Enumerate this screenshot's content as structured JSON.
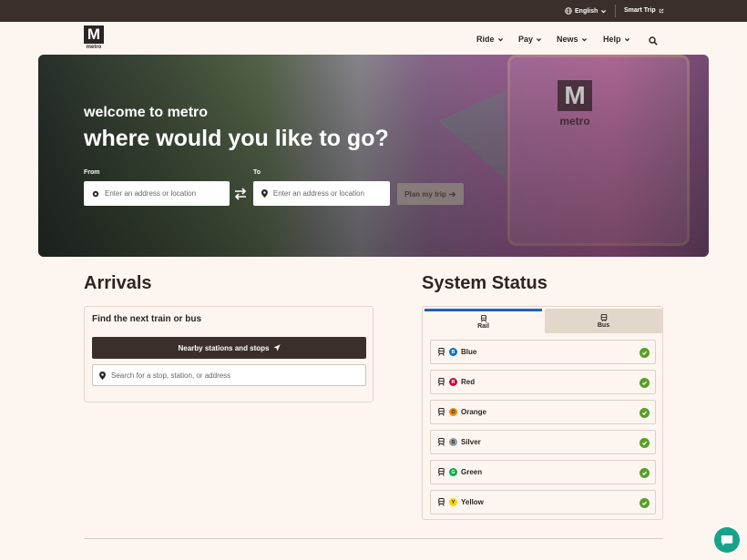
{
  "topbar": {
    "language": "English",
    "smart_trip": "Smart Trip"
  },
  "logo": {
    "mark": "M",
    "word": "metro"
  },
  "nav": {
    "items": [
      "Ride",
      "Pay",
      "News",
      "Help"
    ]
  },
  "hero": {
    "subtitle": "welcome to metro",
    "title": "where would you like to go?",
    "from_label": "From",
    "to_label": "To",
    "from_placeholder": "Enter an address or location",
    "to_placeholder": "Enter an address or location",
    "plan_button": "Plan my trip"
  },
  "arrivals": {
    "title": "Arrivals",
    "card_title": "Find the next train or bus",
    "nearby_button": "Nearby stations and stops",
    "search_placeholder": "Search for a stop, station, or address"
  },
  "status": {
    "title": "System Status",
    "tabs": [
      "Rail",
      "Bus"
    ],
    "lines": [
      {
        "name": "Blue",
        "letter": "B",
        "color": "#0074c8"
      },
      {
        "name": "Red",
        "letter": "R",
        "color": "#bf0d3e"
      },
      {
        "name": "Orange",
        "letter": "O",
        "color": "#ed8b00"
      },
      {
        "name": "Silver",
        "letter": "S",
        "color": "#919d9d"
      },
      {
        "name": "Green",
        "letter": "G",
        "color": "#00b140"
      },
      {
        "name": "Yellow",
        "letter": "Y",
        "color": "#ffd100"
      }
    ]
  },
  "colors": {
    "brand_dark": "#3b2f2c",
    "background": "#fdf6f0",
    "rail_tab": "#1c62c4",
    "ok": "#5a9e2a",
    "chat": "#17a38a"
  }
}
